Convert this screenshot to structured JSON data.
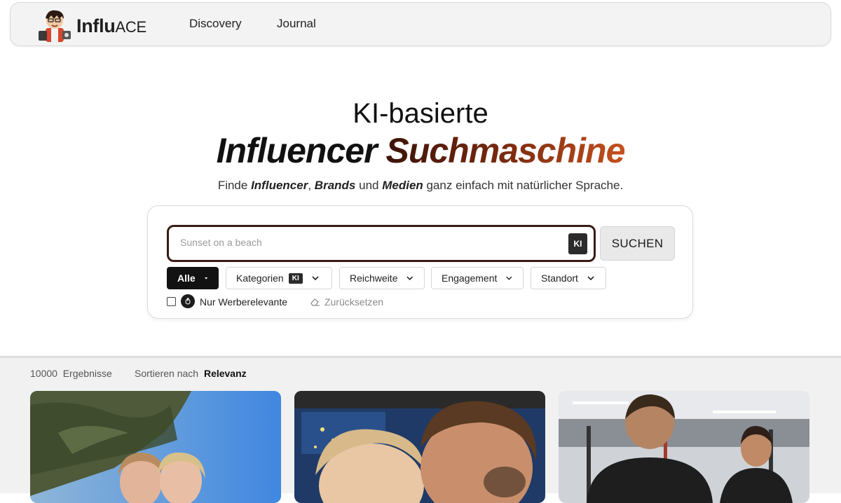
{
  "nav": {
    "brand_bold": "Influ",
    "brand_light": "ACE",
    "links": [
      "Discovery",
      "Journal"
    ]
  },
  "hero": {
    "line1": "KI-basierte",
    "line2_a": "Influencer",
    "line2_b": "Suchmaschine",
    "sub_pre": "Finde",
    "sub_w1": "Influencer",
    "sub_comma": ",",
    "sub_w2": "Brands",
    "sub_und": "und",
    "sub_w3": "Medien",
    "sub_post": "ganz einfach mit natürlicher Sprache."
  },
  "search": {
    "placeholder": "Sunset on a beach",
    "ki_badge": "KI",
    "button": "SUCHEN"
  },
  "filters": [
    {
      "label": "Alle",
      "active": true
    },
    {
      "label": "Kategorien",
      "ki": "KI"
    },
    {
      "label": "Reichweite"
    },
    {
      "label": "Engagement"
    },
    {
      "label": "Standort"
    }
  ],
  "options": {
    "werbe_label": "Nur Werberelevante",
    "werbe_checked": false,
    "reset_label": "Zurücksetzen"
  },
  "results": {
    "count": "10000",
    "count_label": "Ergebnisse",
    "sort_label": "Sortieren nach",
    "sort_value": "Relevanz"
  },
  "cards": [
    {
      "icon": "photo-two-women-selfie"
    },
    {
      "icon": "photo-couple-selfie"
    },
    {
      "icon": "photo-gym-men"
    }
  ]
}
